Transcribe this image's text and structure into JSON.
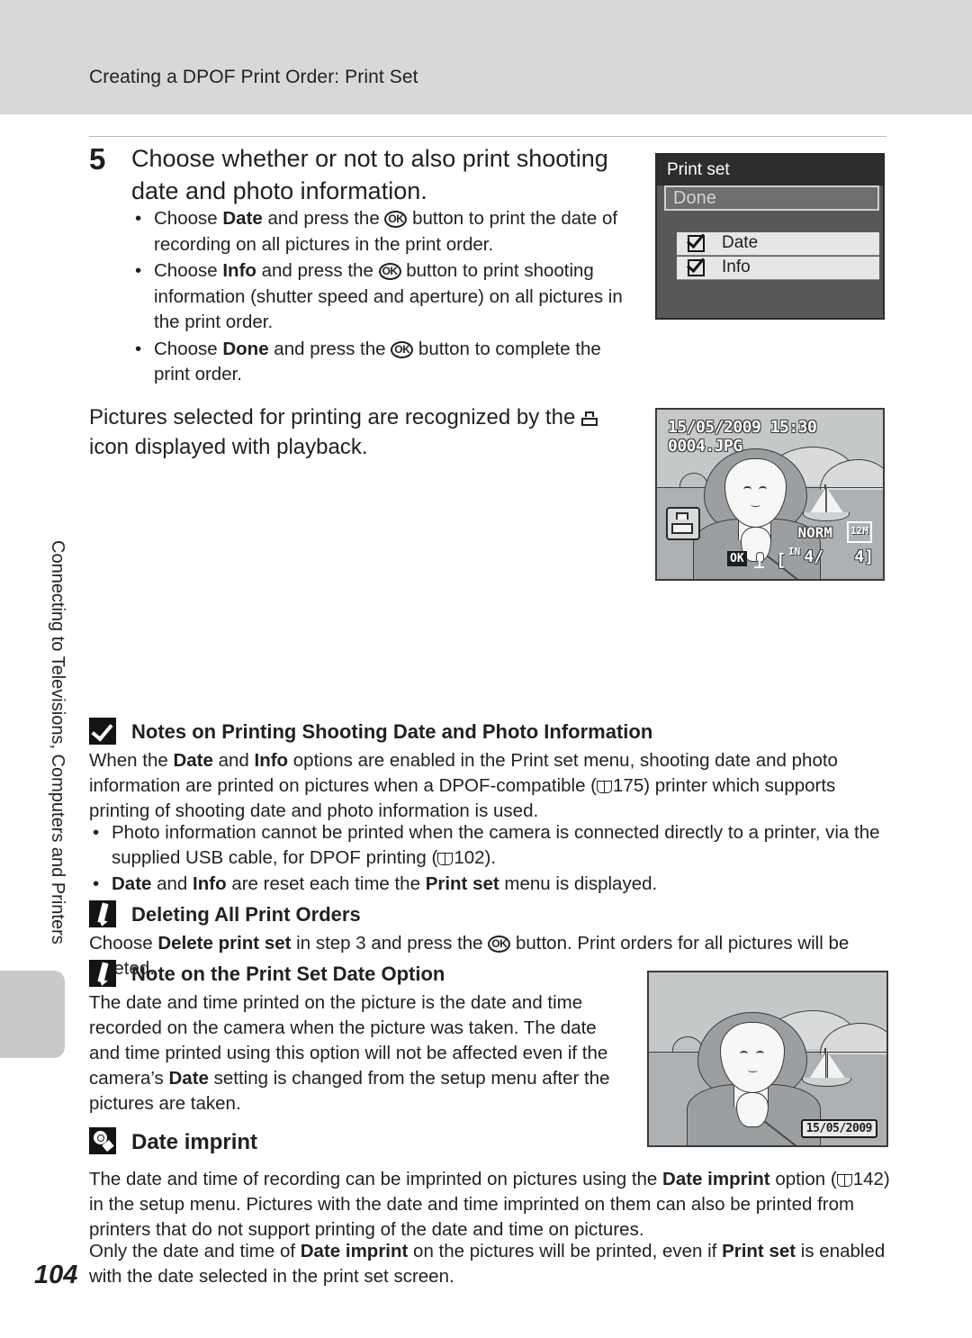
{
  "page": {
    "number": "104",
    "running_header": "Creating a DPOF Print Order: Print Set",
    "side_tab": "Connecting to Televisions, Computers and Printers"
  },
  "step": {
    "number": "5",
    "title": "Choose whether or not to also print shooting date and photo information.",
    "bullets": [
      "Choose Date and press the OK button to print the date of recording on all pictures in the print order.",
      "Choose Info and press the OK button to print shooting information (shutter speed and aperture) on all pictures in the print order.",
      "Choose Done and press the OK button to complete the print order."
    ]
  },
  "main_paragraph": "Pictures selected for printing are recognized by the print icon displayed with playback.",
  "print_set_screen": {
    "title": "Print set",
    "selected_item": "Done",
    "options": [
      {
        "label": "Date",
        "checked": true
      },
      {
        "label": "Info",
        "checked": true
      }
    ]
  },
  "playback_screen": {
    "date": "15/05/2009 15:30",
    "filename": "0004.JPG",
    "quality": "NORM",
    "image_size": "12M",
    "frame_counter_left": "4/",
    "frame_counter_right": "4]",
    "ok_label": "OK",
    "memory_label": "IN",
    "print_badge": "print-order-icon"
  },
  "date_imprint_screen": {
    "stamp": "15/05/2009"
  },
  "notes": {
    "printing_note": {
      "icon": "caution-check-icon",
      "title": "Notes on Printing Shooting Date and Photo Information",
      "body_1": "When the ",
      "body_bold_1": "Date",
      "body_2": " and ",
      "body_bold_2": "Info",
      "body_3": " options are enabled in the Print set menu, shooting date and photo information are printed on pictures when a DPOF-compatible (",
      "page_ref_1": "175",
      "body_4": ") printer which supports printing of shooting date and photo information is used.",
      "bullets": [
        {
          "text_1": "Photo information cannot be printed when the camera is connected directly to a printer, via the supplied USB cable, for DPOF printing (",
          "page_ref": "102",
          "text_2": ")."
        },
        {
          "bold_1": "Date",
          "text_1": " and ",
          "bold_2": "Info",
          "text_2": " are reset each time the ",
          "bold_3": "Print set",
          "text_3": " menu is displayed."
        }
      ]
    },
    "deleting_note": {
      "icon": "pencil-note-icon",
      "title": "Deleting All Print Orders",
      "body_1": "Choose ",
      "body_bold_1": "Delete print set",
      "body_2": " in step 3 and press the ",
      "body_3": " button. Print orders for all pictures will be deleted."
    },
    "date_option_note": {
      "icon": "pencil-note-icon",
      "title": "Note on the Print Set Date Option",
      "body_1": "The date and time printed on the picture is the date and time recorded on the camera when the picture was taken. The date and time printed using this option will not be affected even if the camera’s ",
      "body_bold_1": "Date",
      "body_2": " setting is changed from the setup menu after the pictures are taken."
    },
    "date_imprint_note": {
      "icon": "tip-bulb-icon",
      "title": "Date imprint",
      "para_1_a": "The date and time of recording can be imprinted on pictures using the ",
      "para_1_bold": "Date imprint",
      "para_1_b": " option (",
      "para_1_ref": "142",
      "para_1_c": ") in the setup menu. Pictures with the date and time imprinted on them can also be printed from printers that do not support printing of the date and time on pictures.",
      "para_2_a": "Only the date and time of ",
      "para_2_bold_1": "Date imprint",
      "para_2_b": " on the pictures will be printed, even if ",
      "para_2_bold_2": "Print set",
      "para_2_c": " is enabled with the date selected in the print set screen."
    }
  },
  "colors": {
    "header_band": "#d8d8d8",
    "lcd_dark": "#2d2d2f",
    "lcd_body": "#58585a",
    "ink": "#231f20"
  }
}
